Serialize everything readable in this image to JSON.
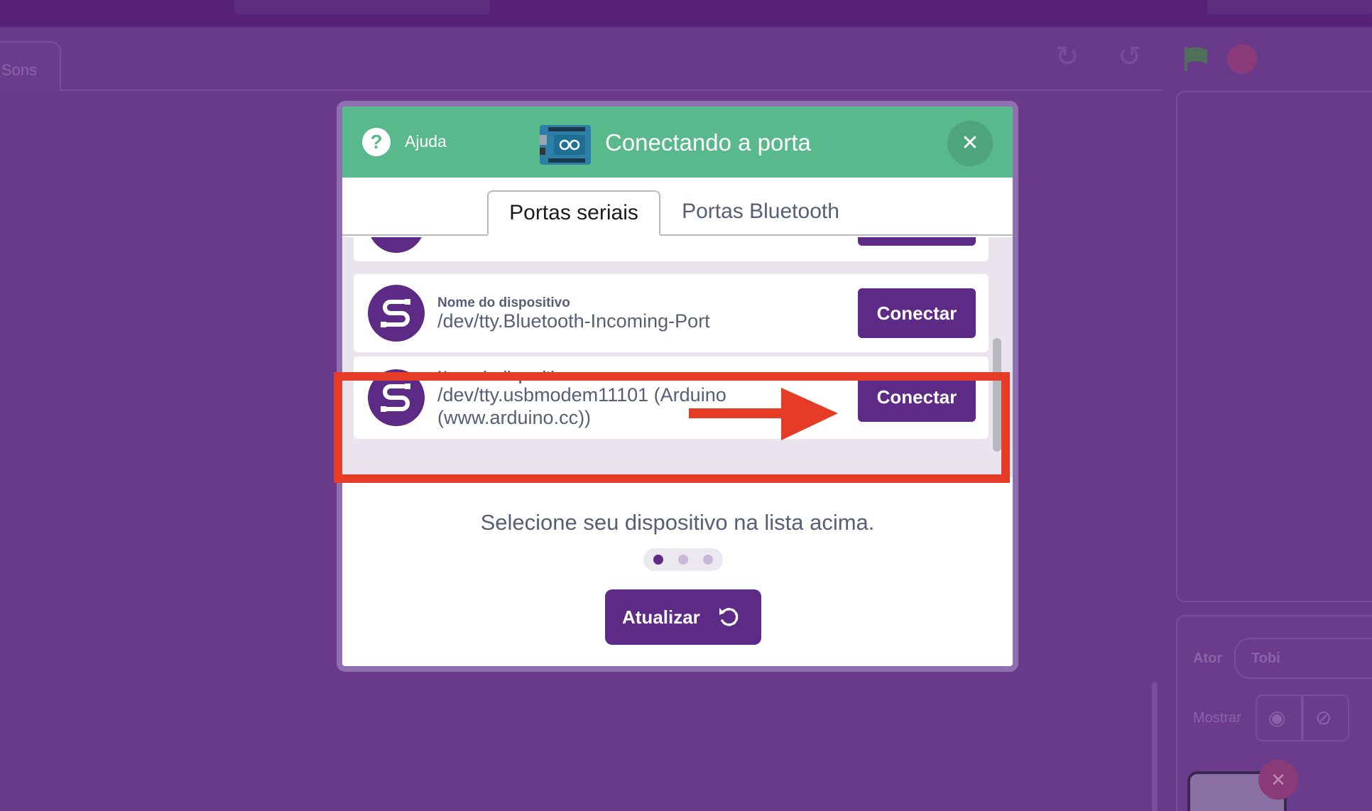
{
  "background": {
    "sounds_tab_label": "Sons",
    "sprite_label": "Ator",
    "sprite_name": "Tobi",
    "show_label": "Mostrar"
  },
  "modal": {
    "help_label": "Ajuda",
    "title": "Conectando a porta",
    "close_icon": "close-icon",
    "tabs": [
      {
        "label": "Portas seriais",
        "active": true
      },
      {
        "label": "Portas Bluetooth",
        "active": false
      }
    ],
    "devices": [
      {
        "caption": "Nome do dispositivo",
        "name": "/dev/tty.Bluetooth-Incoming-Port",
        "button": "Conectar"
      },
      {
        "caption": "Nome do dispositivo",
        "name": "/dev/tty.usbmodem11101 (Arduino (www.arduino.cc))",
        "button": "Conectar"
      }
    ],
    "instruction": "Selecione seu dispositivo na lista acima.",
    "step": {
      "current": 1,
      "total": 3
    },
    "refresh_label": "Atualizar"
  },
  "colors": {
    "header_green": "#59b98c",
    "primary_purple": "#5d2a86",
    "highlight_red": "#e63b26"
  }
}
